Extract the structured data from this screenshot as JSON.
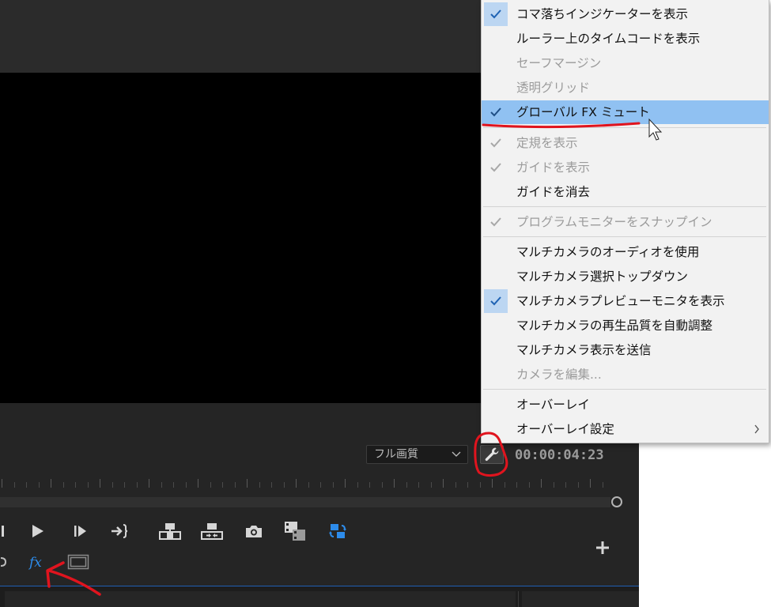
{
  "monitor": {
    "quality_select": {
      "value": "フル画質"
    },
    "timecode": "00:00:04:23"
  },
  "menu": {
    "items": [
      {
        "label": "コマ落ちインジケーターを表示",
        "checked": true,
        "enabled": true
      },
      {
        "label": "ルーラー上のタイムコードを表示",
        "checked": false,
        "enabled": true
      },
      {
        "label": "セーフマージン",
        "checked": false,
        "enabled": false
      },
      {
        "label": "透明グリッド",
        "checked": false,
        "enabled": false
      },
      {
        "label": "グローバル FX ミュート",
        "checked": true,
        "enabled": true,
        "highlighted": true
      },
      {
        "label": "定規を表示",
        "checked": true,
        "enabled": false
      },
      {
        "label": "ガイドを表示",
        "checked": true,
        "enabled": false
      },
      {
        "label": "ガイドを消去",
        "checked": false,
        "enabled": true
      },
      {
        "label": "プログラムモニターをスナップイン",
        "checked": true,
        "enabled": false
      },
      {
        "label": "マルチカメラのオーディオを使用",
        "checked": false,
        "enabled": true
      },
      {
        "label": "マルチカメラ選択トップダウン",
        "checked": false,
        "enabled": true
      },
      {
        "label": "マルチカメラプレビューモニタを表示",
        "checked": true,
        "enabled": true
      },
      {
        "label": "マルチカメラの再生品質を自動調整",
        "checked": false,
        "enabled": true
      },
      {
        "label": "マルチカメラ表示を送信",
        "checked": false,
        "enabled": true
      },
      {
        "label": "カメラを編集...",
        "checked": false,
        "enabled": false
      },
      {
        "label": "オーバーレイ",
        "checked": false,
        "enabled": true
      },
      {
        "label": "オーバーレイ設定",
        "checked": false,
        "enabled": true,
        "submenu": true
      }
    ]
  },
  "icons": {
    "menu_check": "checkmark-icon",
    "settings": "wrench-icon",
    "global_fx": "fx-icon",
    "cursor": "mouse-pointer-icon",
    "add": "plus-icon"
  },
  "colors": {
    "highlight": "#90c1f2",
    "check_bg": "#bcd6f2",
    "fx_blue": "#2d8ceb",
    "annotation_red": "#e0141e"
  }
}
